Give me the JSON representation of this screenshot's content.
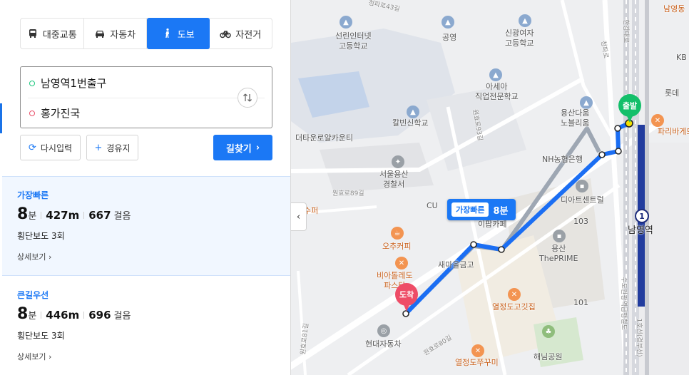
{
  "modes": [
    {
      "label": "대중교통",
      "icon": "bus-icon",
      "active": false
    },
    {
      "label": "자동차",
      "icon": "car-icon",
      "active": false
    },
    {
      "label": "도보",
      "icon": "walk-icon",
      "active": true
    },
    {
      "label": "자전거",
      "icon": "bicycle-icon",
      "active": false
    }
  ],
  "route": {
    "from": "남영역1번출구",
    "to": "홍가진국"
  },
  "actions": {
    "reset": "다시입력",
    "via": "경유지",
    "find": "길찾기"
  },
  "results": [
    {
      "title": "가장빠른",
      "minutes": "8",
      "min_unit": "분",
      "distance": "427m",
      "steps": "667",
      "steps_unit": "걸음",
      "note": "횡단보도 3회",
      "more": "상세보기"
    },
    {
      "title": "큰길우선",
      "minutes": "8",
      "min_unit": "분",
      "distance": "446m",
      "steps": "696",
      "steps_unit": "걸음",
      "note": "횡단보도 3회",
      "more": "상세보기"
    }
  ],
  "map": {
    "route_bubble": {
      "tag": "가장빠른",
      "text": "8분"
    },
    "start_pin": "출발",
    "end_pin": "도착",
    "station_line": "1",
    "labels": {
      "sunrin": "선린인터넷\n고등학교",
      "sinkwang": "신광여자\n고등학교",
      "gongyeong": "공영",
      "asea": "아세아\n직업전문학교",
      "calvin": "칼빈신학교",
      "yongsan_daum": "용산다움\n노블리움",
      "namyeong_dong": "남영동",
      "theuno": "더타운로얄카운티",
      "police": "서울용산\n경찰서",
      "cu": "CU",
      "nh": "NH농협은행",
      "diet": "디아트센트럴",
      "osu": "오추커피",
      "biatolredo": "비아톨레도\n파스타",
      "semaul": "새마을금고",
      "yongsan_prime": "용산\nThePRIME",
      "namyeong_station": "남영역",
      "paris": "파리바게뜨",
      "lotte": "롯데",
      "kb": "KB",
      "yeoljeong_gokit": "열정도고깃집",
      "yeoljeong_jjukkumi": "열정도쭈꾸미",
      "hyundai": "현대자동차",
      "haenim": "해님공원",
      "susu": "수퍼",
      "alpha": "이팝카페",
      "b101": "101",
      "b103": "103",
      "road_89": "원효로89길",
      "road_93": "원효로93길",
      "road_80": "원효로80길",
      "road_81": "원효로81길",
      "road_43": "청파로43길",
      "road_cheongpa": "청파로",
      "road_hangang": "한강대로",
      "line_name": "1호선(경부선)",
      "sudo": "수도권광역급행철도"
    }
  },
  "colors": {
    "accent": "#1b78f5",
    "start": "#13bf6a",
    "end": "#ee4d67",
    "route_fast": "#1b6ef3",
    "route_alt": "#9ea7b3",
    "line1": "#1d2c7c"
  }
}
